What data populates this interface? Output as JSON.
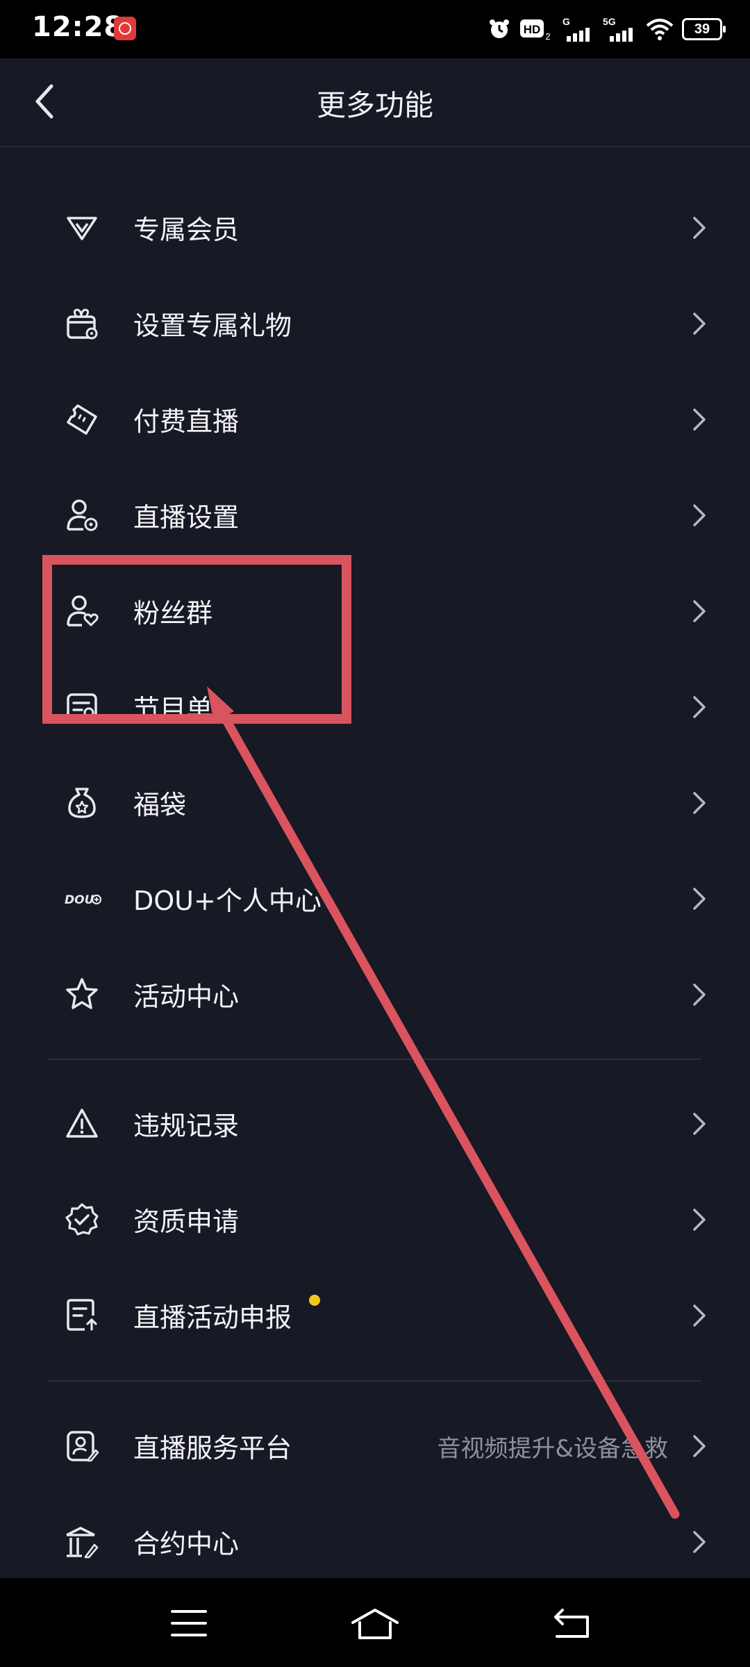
{
  "status": {
    "time": "12:28",
    "battery": "39",
    "hd_label": "HD",
    "net_label_1": "G",
    "net_label_2": "5G"
  },
  "header": {
    "title": "更多功能"
  },
  "menu": {
    "items": [
      {
        "label": "专属会员",
        "icon": "vip-icon"
      },
      {
        "label": "设置专属礼物",
        "icon": "gift-icon"
      },
      {
        "label": "付费直播",
        "icon": "ticket-icon"
      },
      {
        "label": "直播设置",
        "icon": "user-settings-icon"
      },
      {
        "label": "粉丝群",
        "icon": "fan-group-icon"
      },
      {
        "label": "节目单",
        "icon": "program-list-icon"
      },
      {
        "label": "福袋",
        "icon": "lucky-bag-icon"
      },
      {
        "label": "DOU+个人中心",
        "icon": "dou-plus-icon",
        "icon_text": "DOU"
      },
      {
        "label": "活动中心",
        "icon": "star-icon"
      },
      {
        "label": "违规记录",
        "icon": "warning-icon"
      },
      {
        "label": "资质申请",
        "icon": "verified-badge-icon"
      },
      {
        "label": "直播活动申报",
        "icon": "report-upload-icon",
        "badge_color": "#f5c518"
      },
      {
        "label": "直播服务平台",
        "icon": "service-platform-icon",
        "subtitle": "音视频提升&设备急救"
      },
      {
        "label": "合约中心",
        "icon": "contract-icon"
      }
    ]
  },
  "annotation": {
    "color": "#d9545e"
  }
}
